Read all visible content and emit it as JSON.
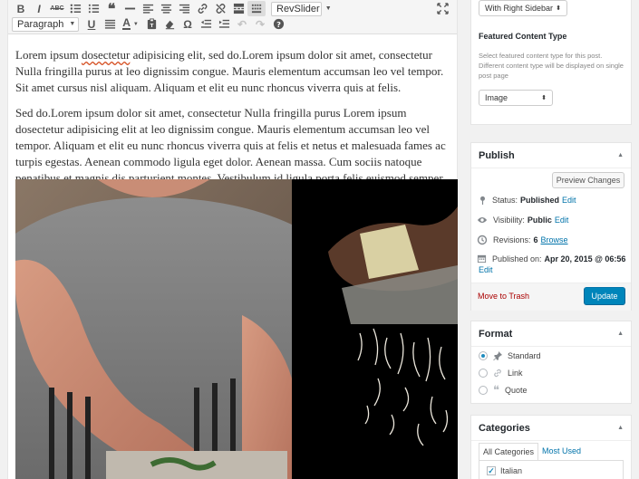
{
  "toolbar": {
    "row1": [
      "B",
      "I",
      "ABC",
      "bullets",
      "numbers",
      "quote",
      "hr",
      "align-left",
      "align-center",
      "align-right",
      "link",
      "unlink",
      "more",
      "toolbar-toggle"
    ],
    "revslider_label": "RevSlider",
    "format_select": "Paragraph",
    "fullscreen_label": "fullscreen"
  },
  "content": {
    "p1_start": "Lorem ipsum ",
    "p1_misspelled": "dosectetur",
    "p1_rest": " adipisicing elit, sed do.Lorem ipsum dolor sit amet, consectetur Nulla fringilla purus at leo dignissim congue. Mauris elementum accumsan leo vel tempor. Sit amet cursus nisl aliquam. Aliquam et elit eu nunc rhoncus viverra quis at felis.",
    "p2": "Sed do.Lorem ipsum dolor sit amet, consectetur Nulla fringilla purus Lorem ipsum dosectetur adipisicing elit at leo dignissim congue. Mauris elementum accumsan leo vel tempor. Aliquam et elit eu nunc rhoncus viverra quis at felis et netus et malesuada fames ac turpis egestas. Aenean commodo ligula eget dolor. Aenean massa. Cum sociis natoque penatibus et magnis dis parturient montes. Vestibulum id ligula porta felis euismod semper. Vestibulum id ligula porta felis euismod semper."
  },
  "layout_panel": {
    "template_select": "With Right Sidebar"
  },
  "featured": {
    "title": "Featured Content Type",
    "help": "Select featured content type for this post. Different content type will be displayed on single post page",
    "select": "Image"
  },
  "publish": {
    "title": "Publish",
    "preview_button": "Preview Changes",
    "status_label": "Status:",
    "status_value": "Published",
    "visibility_label": "Visibility:",
    "visibility_value": "Public",
    "revisions_label": "Revisions:",
    "revisions_value": "6",
    "published_label": "Published on:",
    "published_value": "Apr 20, 2015 @ 06:56",
    "edit_link": "Edit",
    "browse_link": "Browse",
    "trash_link": "Move to Trash",
    "update_button": "Update"
  },
  "format": {
    "title": "Format",
    "options": [
      "Standard",
      "Link",
      "Quote"
    ],
    "selected": "Standard"
  },
  "categories": {
    "title": "Categories",
    "tab_all": "All Categories",
    "tab_used": "Most Used",
    "items": [
      "Italian"
    ]
  },
  "colors": {
    "accent": "#0085ba",
    "link": "#0073aa",
    "trash": "#aa0000"
  }
}
